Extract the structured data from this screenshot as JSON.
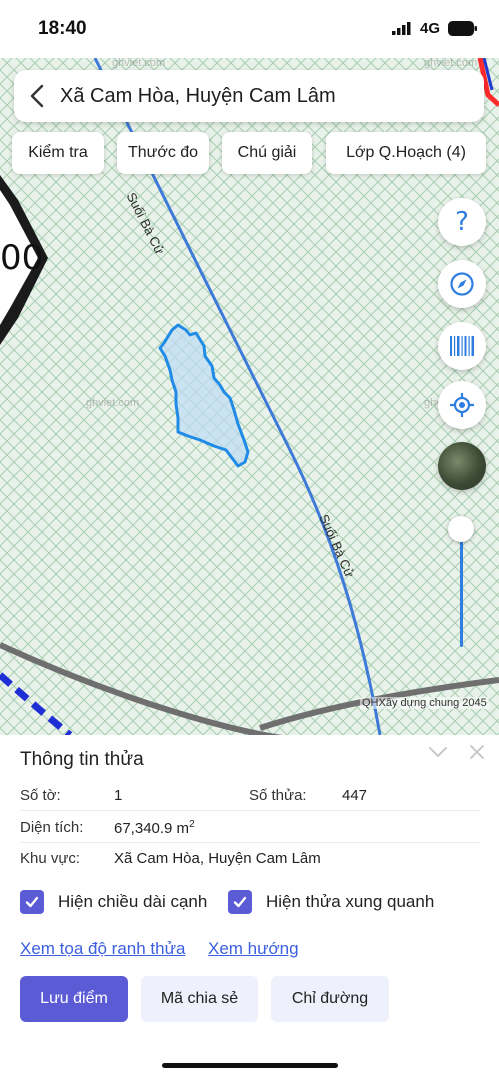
{
  "status_bar": {
    "time": "18:40",
    "network": "4G"
  },
  "header": {
    "title": "Xã Cam Hòa, Huyện Cam Lâm"
  },
  "toolbar": {
    "check": "Kiểm tra",
    "measure": "Thước đo",
    "legend": "Chú giải",
    "layers": "Lớp Q.Hoạch (4)"
  },
  "map": {
    "stream_label_top": "Suối Bà Cử",
    "stream_label_bottom": "Suối Bà Cử",
    "road_marker": "00",
    "watermark": "ghviet.com",
    "attribution": "QHXây dựng chung 2045",
    "help_symbol": "?",
    "colors": {
      "hatch": "#9fc9a8",
      "parcel": "#1f8be6",
      "stream": "#3e7ad8"
    }
  },
  "panel": {
    "title": "Thông tin thửa",
    "sheet_label": "Số tờ:",
    "sheet_value": "1",
    "parcel_label": "Số thửa:",
    "parcel_value": "447",
    "area_label": "Diện tích:",
    "area_value": "67,340.9 m",
    "area_unit_sup": "2",
    "region_label": "Khu vực:",
    "region_value": "Xã Cam Hòa, Huyện Cam Lâm",
    "show_edge_lengths": "Hiện chiều dài cạnh",
    "show_neighbors": "Hiện thửa xung quanh",
    "link_coords": "Xem tọa độ ranh thửa",
    "link_direction": "Xem hướng",
    "save_point": "Lưu điểm",
    "share_code": "Mã chia sẻ",
    "directions": "Chỉ đường"
  }
}
